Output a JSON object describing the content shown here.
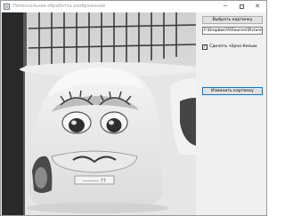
{
  "window": {
    "title": "Попиксельная обработка изображений",
    "minimize_glyph": "─",
    "close_glyph": "✕"
  },
  "controls": {
    "choose_image_label": "Выбрать картинку",
    "path_value": "F:\\Dropbox\\VSSources\\Picture\\Pic",
    "checkbox_checked": true,
    "checkbox_mark": "✓",
    "grayscale_label": "Сделать чёрно-белым",
    "change_image_label": "Изменить картинку"
  },
  "picture": {
    "mode": "grayscale",
    "license_plate_text": "────── 77"
  },
  "colors": {
    "change_button_border": "#0078d7",
    "titlebar_text": "#9a9a9a"
  },
  "icons": {
    "app": "window-app-icon",
    "minimize": "minimize-icon",
    "maximize": "maximize-icon",
    "close": "close-icon",
    "checkbox": "checkmark-icon"
  }
}
